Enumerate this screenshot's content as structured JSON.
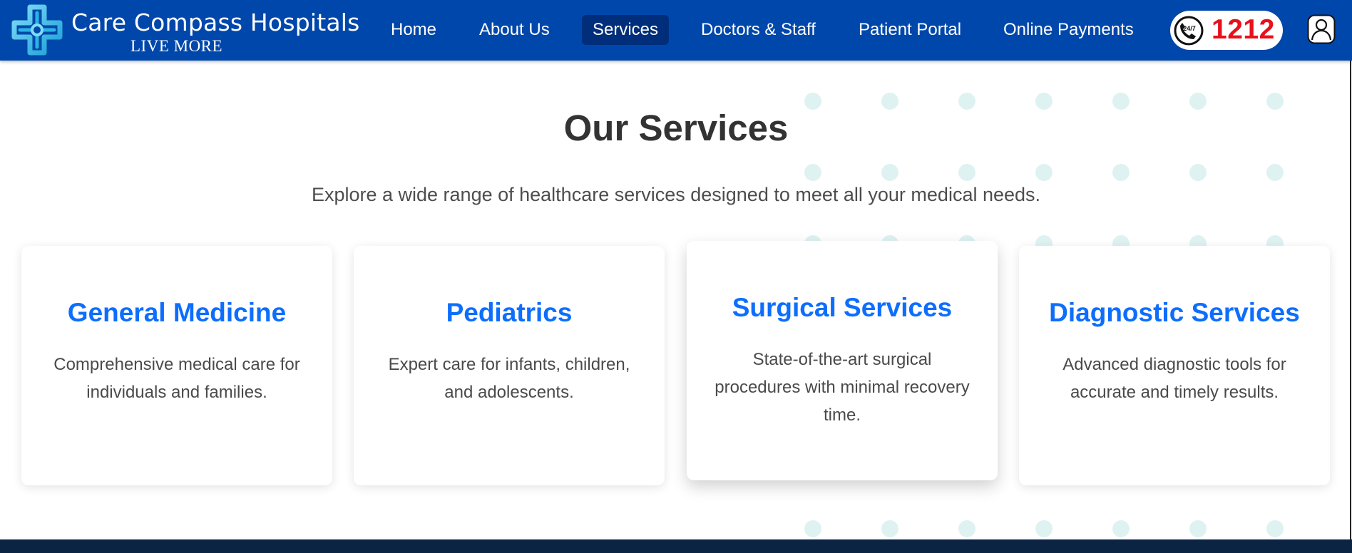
{
  "brand": {
    "name": "Care Compass Hospitals",
    "tagline": "LIVE MORE",
    "logo_icon": "medical-cross-logo"
  },
  "nav": {
    "items": [
      {
        "label": "Home",
        "active": false
      },
      {
        "label": "About Us",
        "active": false
      },
      {
        "label": "Services",
        "active": true
      },
      {
        "label": "Doctors & Staff",
        "active": false
      },
      {
        "label": "Patient Portal",
        "active": false
      },
      {
        "label": "Online Payments",
        "active": false
      }
    ]
  },
  "hotline": {
    "icon": "phone-24-7-icon",
    "icon_badge": "24/7",
    "number": "1212"
  },
  "profile": {
    "icon": "user-profile-icon"
  },
  "services": {
    "title": "Our Services",
    "subtitle": "Explore a wide range of healthcare services designed to meet all your medical needs.",
    "cards": [
      {
        "title": "General Medicine",
        "description": "Comprehensive medical care for individuals and families."
      },
      {
        "title": "Pediatrics",
        "description": "Expert care for infants, children, and adolescents."
      },
      {
        "title": "Surgical Services",
        "description": "State-of-the-art surgical procedures with minimal recovery time."
      },
      {
        "title": "Diagnostic Services",
        "description": "Advanced diagnostic tools for accurate and timely results."
      }
    ]
  },
  "colors": {
    "header": "#0047ab",
    "nav_active": "#002e7a",
    "card_title": "#0d6efd",
    "hotline_number": "#e8101a",
    "footer": "#0b2444",
    "dot": "#dff2f2"
  }
}
